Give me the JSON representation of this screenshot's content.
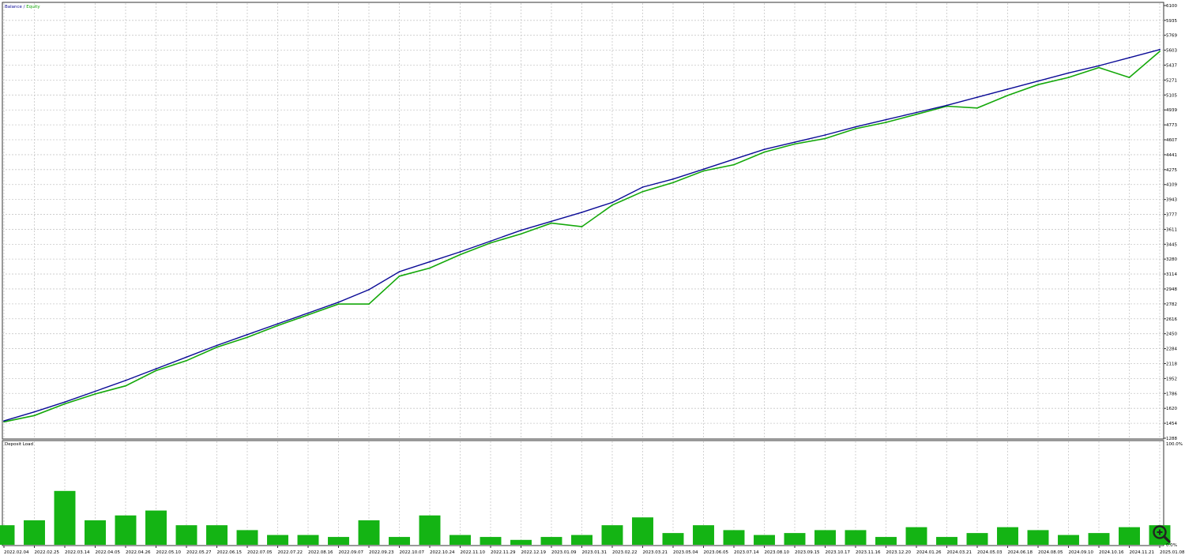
{
  "legend": {
    "balance_label": "Balance",
    "separator": " / ",
    "equity_label": "Equity"
  },
  "lower_panel": {
    "title": "Deposit Load",
    "max_label": "100.0%",
    "min_label": "0.0%"
  },
  "colors": {
    "balance": "#0a0a96",
    "equity": "#14a80a",
    "deposit_load": "#14b414",
    "grid": "#c8c8c8",
    "axis": "#333333"
  },
  "zoom_icon": "magnifier-plus-icon",
  "chart_data": [
    {
      "type": "line",
      "title": "",
      "xlabel": "",
      "ylabel": "",
      "grid": true,
      "legend_position": "top-left",
      "ylim": [
        1288,
        6100
      ],
      "y_ticks": [
        "6100",
        "5935",
        "5769",
        "5603",
        "5437",
        "5271",
        "5105",
        "4939",
        "4773",
        "4607",
        "4441",
        "4275",
        "4109",
        "3943",
        "3777",
        "3611",
        "3445",
        "3280",
        "3114",
        "2948",
        "2782",
        "2616",
        "2450",
        "2284",
        "2118",
        "1952",
        "1786",
        "1620",
        "1454",
        "1288"
      ],
      "x_ticks": [
        "2022.02.04",
        "2022.02.25",
        "2022.03.14",
        "2022.04.05",
        "2022.04.26",
        "2022.05.10",
        "2022.05.27",
        "2022.06.15",
        "2022.07.05",
        "2022.07.22",
        "2022.08.16",
        "2022.09.07",
        "2022.09.23",
        "2022.10.07",
        "2022.10.24",
        "2022.11.10",
        "2022.11.29",
        "2022.12.19",
        "2023.01.09",
        "2023.01.31",
        "2023.02.22",
        "2023.03.21",
        "2023.05.04",
        "2023.06.05",
        "2023.07.14",
        "2023.08.10",
        "2023.09.15",
        "2023.10.17",
        "2023.11.16",
        "2023.12.20",
        "2024.01.26",
        "2024.03.21",
        "2024.05.03",
        "2024.06.18",
        "2024.08.05",
        "2024.09.10",
        "2024.10.16",
        "2024.11.21",
        "2025.01.08"
      ],
      "series": [
        {
          "name": "Balance",
          "x": [
            "2022.02.04",
            "2022.02.25",
            "2022.03.14",
            "2022.04.05",
            "2022.04.26",
            "2022.05.10",
            "2022.05.27",
            "2022.06.15",
            "2022.07.05",
            "2022.07.22",
            "2022.08.16",
            "2022.09.07",
            "2022.09.23",
            "2022.10.07",
            "2022.10.24",
            "2022.11.10",
            "2022.11.29",
            "2022.12.19",
            "2023.01.09",
            "2023.01.31",
            "2023.02.22",
            "2023.03.21",
            "2023.05.04",
            "2023.06.05",
            "2023.07.14",
            "2023.08.10",
            "2023.09.15",
            "2023.10.17",
            "2023.11.16",
            "2023.12.20",
            "2024.01.26",
            "2024.03.21",
            "2024.05.03",
            "2024.06.18",
            "2024.08.05",
            "2024.09.10",
            "2024.10.16",
            "2024.11.21",
            "2025.01.08"
          ],
          "values": [
            1480,
            1580,
            1690,
            1810,
            1930,
            2060,
            2190,
            2320,
            2440,
            2560,
            2680,
            2800,
            2940,
            3140,
            3250,
            3360,
            3480,
            3600,
            3700,
            3800,
            3910,
            4080,
            4170,
            4280,
            4390,
            4500,
            4580,
            4660,
            4750,
            4830,
            4910,
            4990,
            5080,
            5170,
            5260,
            5350,
            5430,
            5520,
            5610
          ]
        },
        {
          "name": "Equity",
          "x": [
            "2022.02.04",
            "2022.02.25",
            "2022.03.14",
            "2022.04.05",
            "2022.04.26",
            "2022.05.10",
            "2022.05.27",
            "2022.06.15",
            "2022.07.05",
            "2022.07.22",
            "2022.08.16",
            "2022.09.07",
            "2022.09.23",
            "2022.10.07",
            "2022.10.24",
            "2022.11.10",
            "2022.11.29",
            "2022.12.19",
            "2023.01.09",
            "2023.01.31",
            "2023.02.22",
            "2023.03.21",
            "2023.05.04",
            "2023.06.05",
            "2023.07.14",
            "2023.08.10",
            "2023.09.15",
            "2023.10.17",
            "2023.11.16",
            "2023.12.20",
            "2024.01.26",
            "2024.03.21",
            "2024.05.03",
            "2024.06.18",
            "2024.08.05",
            "2024.09.10",
            "2024.10.16",
            "2024.11.21",
            "2025.01.08"
          ],
          "values": [
            1470,
            1540,
            1670,
            1780,
            1870,
            2040,
            2150,
            2300,
            2410,
            2540,
            2660,
            2780,
            2780,
            3090,
            3180,
            3330,
            3460,
            3560,
            3680,
            3640,
            3880,
            4030,
            4130,
            4260,
            4330,
            4470,
            4560,
            4620,
            4730,
            4800,
            4890,
            4980,
            4960,
            5100,
            5220,
            5300,
            5410,
            5300,
            5590
          ]
        }
      ]
    },
    {
      "type": "bar",
      "title": "",
      "xlabel": "",
      "ylabel": "",
      "ylim": [
        0,
        100
      ],
      "categories": [
        "2022.02.04",
        "2022.02.25",
        "2022.03.14",
        "2022.04.05",
        "2022.04.26",
        "2022.05.10",
        "2022.05.27",
        "2022.06.15",
        "2022.07.05",
        "2022.07.22",
        "2022.08.16",
        "2022.09.07",
        "2022.09.23",
        "2022.10.07",
        "2022.10.24",
        "2022.11.10",
        "2022.11.29",
        "2022.12.19",
        "2023.01.09",
        "2023.01.31",
        "2023.02.22",
        "2023.03.21",
        "2023.05.04",
        "2023.06.05",
        "2023.07.14",
        "2023.08.10",
        "2023.09.15",
        "2023.10.17",
        "2023.11.16",
        "2023.12.20",
        "2024.01.26",
        "2024.03.21",
        "2024.05.03",
        "2024.06.18",
        "2024.08.05",
        "2024.09.10",
        "2024.10.16",
        "2024.11.21",
        "2025.01.08"
      ],
      "series": [
        {
          "name": "Deposit Load",
          "values": [
            20,
            25,
            55,
            25,
            30,
            35,
            20,
            20,
            15,
            10,
            10,
            8,
            25,
            8,
            30,
            10,
            8,
            5,
            8,
            10,
            20,
            28,
            12,
            20,
            15,
            10,
            12,
            15,
            15,
            8,
            18,
            8,
            12,
            18,
            15,
            10,
            12,
            18,
            20
          ]
        }
      ]
    }
  ]
}
